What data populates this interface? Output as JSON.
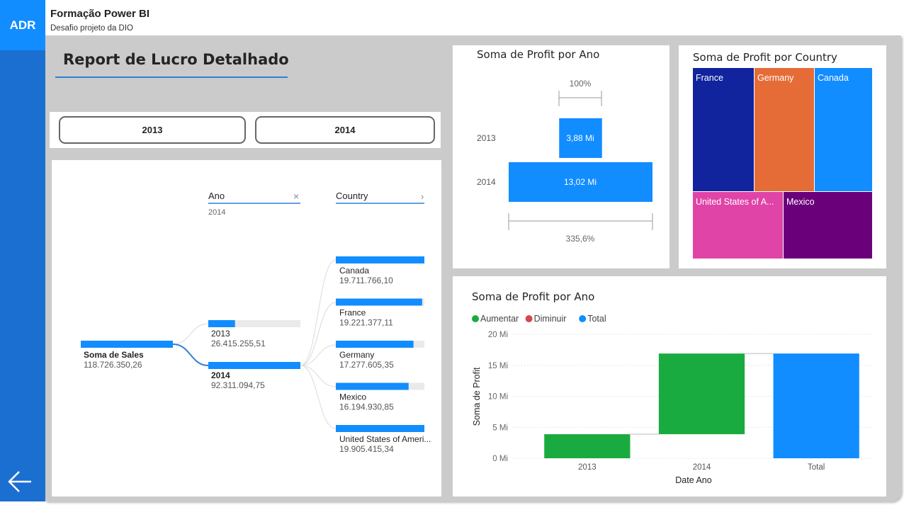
{
  "rail": {
    "badge": "ADR",
    "back_icon": "arrow-left-icon"
  },
  "header": {
    "title": "Formação Power BI",
    "subtitle": "Desafio projeto da DIO"
  },
  "report": {
    "title": "Report de Lucro Detalhado"
  },
  "slicer": {
    "buttons": [
      "2013",
      "2014"
    ]
  },
  "decomp_tree": {
    "root": {
      "label": "Soma de Sales",
      "value": "118.726.350,26"
    },
    "level1": {
      "header": "Ano",
      "selected": "2014",
      "close_icon": "close-icon",
      "items": [
        {
          "label": "2013",
          "value": "26.415.255,51",
          "fraction": 0.29
        },
        {
          "label": "2014",
          "value": "92.311.094,75",
          "fraction": 1.0
        }
      ]
    },
    "level2": {
      "header": "Country",
      "expand_icon": "chevron-right-icon",
      "items": [
        {
          "label": "Canada",
          "value": "19.711.766,10",
          "fraction": 1.0
        },
        {
          "label": "France",
          "value": "19.221.377,11",
          "fraction": 0.975
        },
        {
          "label": "Germany",
          "value": "17.277.605,35",
          "fraction": 0.877
        },
        {
          "label": "Mexico",
          "value": "16.194.930,85",
          "fraction": 0.822
        },
        {
          "label": "United States of Ameri...",
          "value": "19.905.415,34",
          "fraction": 1.0
        }
      ]
    }
  },
  "funnel": {
    "title": "Soma de Profit por Ano",
    "top_label": "100%",
    "bottom_label": "335,6%",
    "rows": [
      {
        "year": "2013",
        "value_label": "3,88 Mi",
        "value": 3.88
      },
      {
        "year": "2014",
        "value_label": "13,02 Mi",
        "value": 13.02
      }
    ]
  },
  "treemap": {
    "title": "Soma de Profit por Country",
    "tiles": [
      {
        "label": "France",
        "color": "#12239e"
      },
      {
        "label": "Germany",
        "color": "#e66c37"
      },
      {
        "label": "Canada",
        "color": "#118dff"
      },
      {
        "label": "United States of A...",
        "color": "#e044a7"
      },
      {
        "label": "Mexico",
        "color": "#6b007b"
      }
    ]
  },
  "chart_data": {
    "type": "bar",
    "subtype": "waterfall",
    "title": "Soma de Profit por Ano",
    "xlabel": "Date Ano",
    "ylabel": "Soma de Profit",
    "categories": [
      "2013",
      "2014",
      "Total"
    ],
    "values": [
      3.88,
      13.02,
      16.9
    ],
    "ylim": [
      0,
      20
    ],
    "yticks": [
      "0 Mi",
      "5 Mi",
      "10 Mi",
      "15 Mi",
      "20 Mi"
    ],
    "legend": [
      {
        "name": "Aumentar",
        "color": "#1aab40"
      },
      {
        "name": "Diminuir",
        "color": "#d64554"
      },
      {
        "name": "Total",
        "color": "#118dff"
      }
    ],
    "legend_position": "top-left",
    "grid": true
  }
}
